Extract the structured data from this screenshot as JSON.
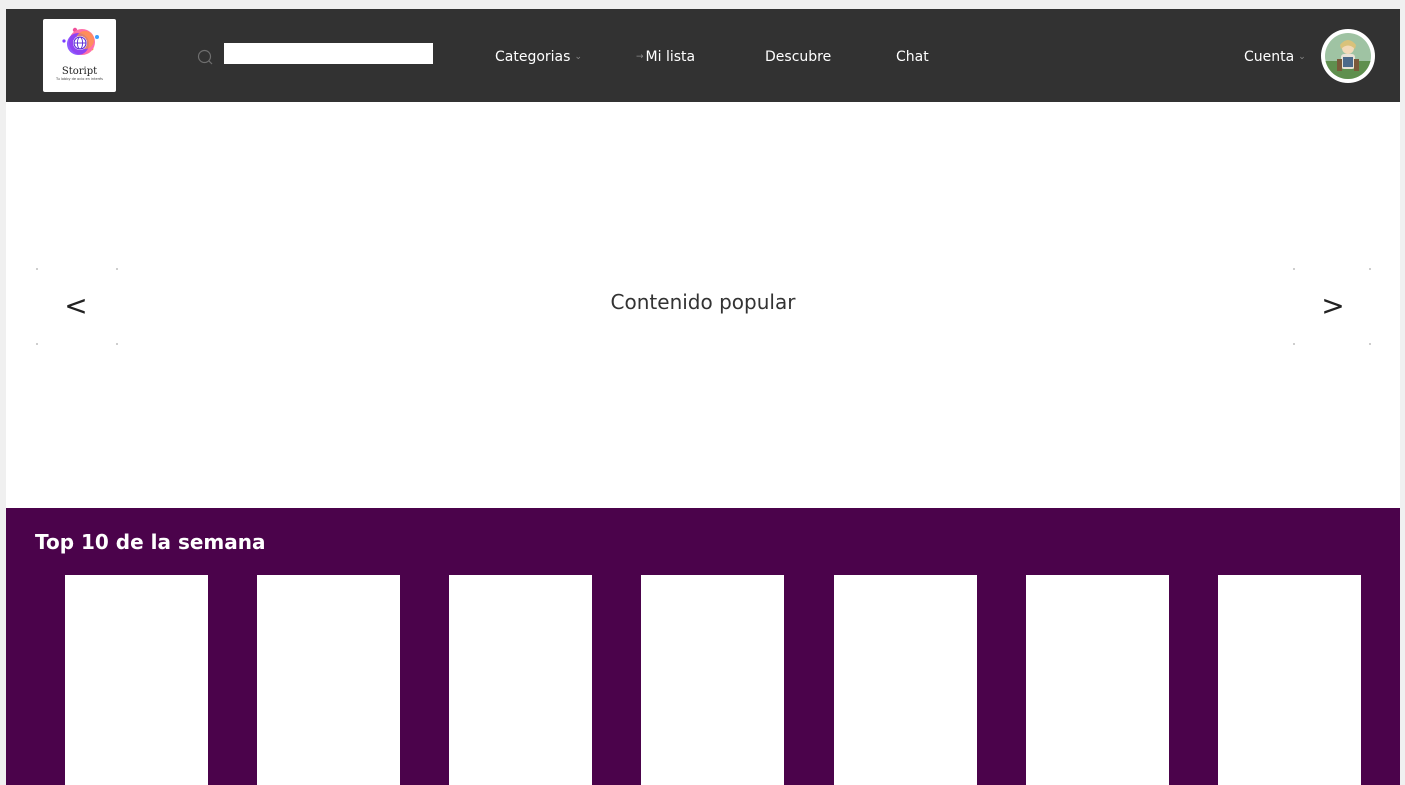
{
  "brand": {
    "name": "Stoript",
    "tagline": "Tu lobby de ocio en interés"
  },
  "search": {
    "value": "",
    "placeholder": ""
  },
  "nav": {
    "categorias": "Categorias",
    "mi_lista": "Mi lista",
    "descubre": "Descubre",
    "chat": "Chat",
    "cuenta": "Cuenta"
  },
  "icons": {
    "search": "search-icon",
    "caret": "chevron-down-icon",
    "avatar": "avatar-image"
  },
  "hero": {
    "title": "Contenido popular",
    "prev": "<",
    "next": ">"
  },
  "top10": {
    "title": "Top 10 de la semana",
    "cards": [
      "",
      "",
      "",
      "",
      "",
      "",
      ""
    ]
  },
  "colors": {
    "navbar": "#323232",
    "top_section": "#4b034b",
    "card": "#ffffff"
  }
}
